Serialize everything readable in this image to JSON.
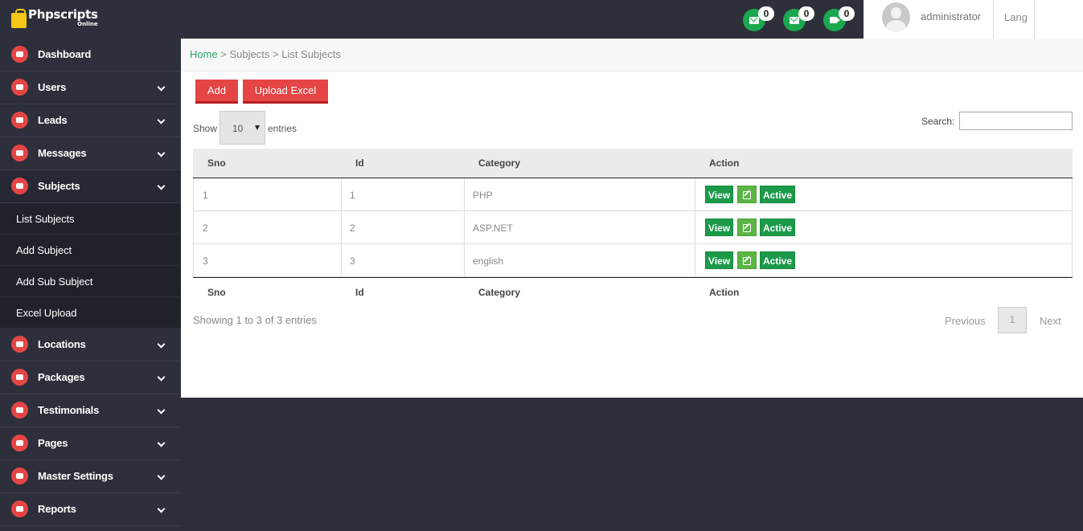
{
  "brand": {
    "name": "Phpscripts",
    "sub": "Online"
  },
  "notifications": [
    {
      "icon": "mail-icon",
      "count": "0"
    },
    {
      "icon": "mail-icon",
      "count": "0"
    },
    {
      "icon": "video-icon",
      "count": "0"
    }
  ],
  "user": {
    "name": "administrator",
    "lang": "Lang"
  },
  "sidebar": {
    "items": [
      {
        "label": "Dashboard",
        "icon": "cloud-icon"
      },
      {
        "label": "Users",
        "icon": "user-icon"
      },
      {
        "label": "Leads",
        "icon": "video-icon"
      },
      {
        "label": "Messages",
        "icon": "chat-icon"
      },
      {
        "label": "Subjects",
        "icon": "copy-icon"
      },
      {
        "label": "Locations",
        "icon": "location-arrow-icon"
      },
      {
        "label": "Packages",
        "icon": "dropbox-icon"
      },
      {
        "label": "Testimonials",
        "icon": "quote-icon"
      },
      {
        "label": "Pages",
        "icon": "sitemap-icon"
      },
      {
        "label": "Master Settings",
        "icon": "cogs-icon"
      },
      {
        "label": "Reports",
        "icon": "list-icon"
      }
    ],
    "subjects_sub": [
      "List Subjects",
      "Add Subject",
      "Add Sub Subject",
      "Excel Upload"
    ]
  },
  "breadcrumb": {
    "home": "Home",
    "sep": " > ",
    "section": "Subjects",
    "page": "List Subjects"
  },
  "toolbar": {
    "add": "Add",
    "upload": "Upload Excel"
  },
  "table_controls": {
    "show": "Show",
    "entries_value": "10",
    "entries": "entries",
    "search_label": "Search:",
    "search_value": ""
  },
  "table": {
    "columns": [
      "Sno",
      "Id",
      "Category",
      "Action"
    ],
    "rows": [
      {
        "sno": "1",
        "id": "1",
        "category": "PHP"
      },
      {
        "sno": "2",
        "id": "2",
        "category": "ASP.NET"
      },
      {
        "sno": "3",
        "id": "3",
        "category": "english"
      }
    ],
    "actions": {
      "view": "View",
      "active": "Active"
    }
  },
  "footer": {
    "info": "Showing 1 to 3 of 3 entries",
    "prev": "Previous",
    "page": "1",
    "next": "Next"
  },
  "colors": {
    "accent_red": "#e54545",
    "green": "#1c9a4a",
    "dark_bg": "#2d303b"
  }
}
